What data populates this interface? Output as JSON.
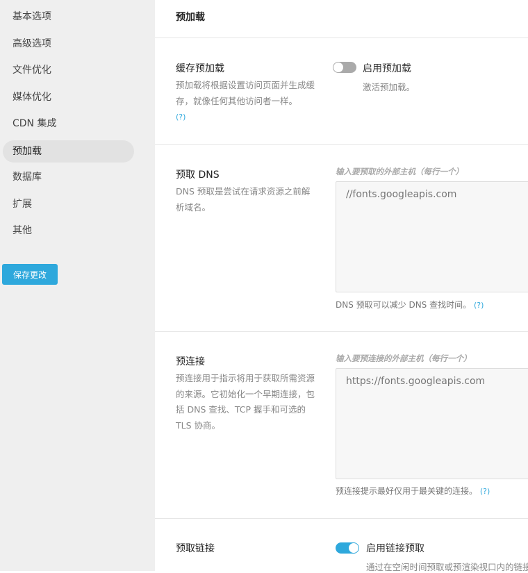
{
  "sidebar": {
    "items": [
      {
        "label": "基本选项"
      },
      {
        "label": "高级选项"
      },
      {
        "label": "文件优化"
      },
      {
        "label": "媒体优化"
      },
      {
        "label": "CDN 集成"
      },
      {
        "label": "预加载",
        "active": true
      },
      {
        "label": "数据库"
      },
      {
        "label": "扩展"
      },
      {
        "label": "其他"
      }
    ],
    "save_label": "保存更改"
  },
  "header": {
    "title": "预加载"
  },
  "cache_preload": {
    "title": "缓存预加载",
    "desc": "预加载将根据设置访问页面并生成缓存，就像任何其他访问者一样。",
    "help": "(?)",
    "toggle_label": "启用预加载",
    "toggle_sub": "激活预加载。",
    "enabled": false
  },
  "dns_prefetch": {
    "title": "预取 DNS",
    "desc": "DNS 预取是尝试在请求资源之前解析域名。",
    "input_label": "输入要预取的外部主机（每行一个）",
    "placeholder": "//fonts.googleapis.com",
    "hint": "DNS 预取可以减少 DNS 查找时间。",
    "help": "(?)"
  },
  "preconnect": {
    "title": "预连接",
    "desc": "预连接用于指示将用于获取所需资源的来源。它初始化一个早期连接，包括 DNS 查找、TCP 握手和可选的 TLS 协商。",
    "input_label": "输入要预连接的外部主机（每行一个）",
    "placeholder": "https://fonts.googleapis.com",
    "hint": "预连接提示最好仅用于最关键的连接。",
    "help": "(?)"
  },
  "link_prefetch": {
    "title": "预取链接",
    "toggle_label": "启用链接预取",
    "toggle_sub": "通过在空闲时间预取或预渲染视口内的链接",
    "enabled": true
  },
  "colors": {
    "accent": "#2ea8dc",
    "toggle_off": "#aaaaaa"
  }
}
